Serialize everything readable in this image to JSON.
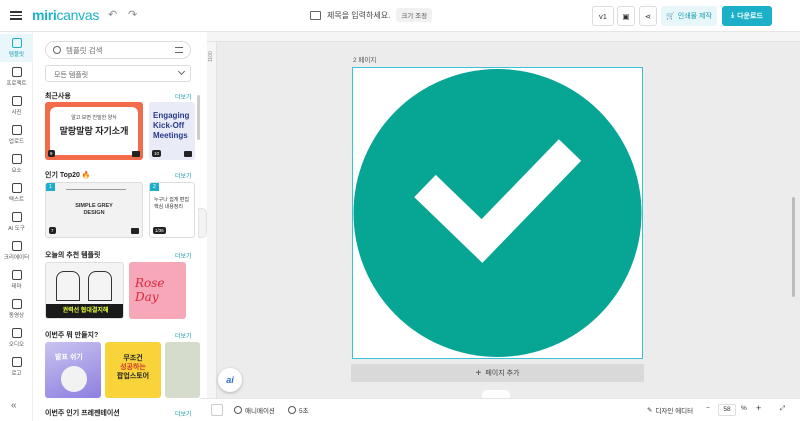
{
  "app": {
    "logo_text": "miri",
    "logo_text2": "canvas",
    "title_placeholder": "제목을 입력하세요.",
    "size_chip": "크기 조정",
    "version": "v1",
    "print_label": "인쇄물 제작",
    "download_label": "다운로드"
  },
  "rail": [
    {
      "label": "템플릿",
      "icon": "template-icon"
    },
    {
      "label": "프로젝트",
      "icon": "project-icon"
    },
    {
      "label": "사진",
      "icon": "photo-icon"
    },
    {
      "label": "업로드",
      "icon": "upload-icon"
    },
    {
      "label": "요소",
      "icon": "elements-icon"
    },
    {
      "label": "텍스트",
      "icon": "text-icon"
    },
    {
      "label": "AI 도구",
      "icon": "ai-tools-icon"
    },
    {
      "label": "크리에이터",
      "icon": "creator-icon"
    },
    {
      "label": "테마",
      "icon": "theme-icon"
    },
    {
      "label": "동영상",
      "icon": "video-icon"
    },
    {
      "label": "오디오",
      "icon": "audio-icon"
    },
    {
      "label": "로고",
      "icon": "logo-icon"
    }
  ],
  "panel": {
    "search_placeholder": "템플릿 검색",
    "select_value": "모든 템플릿",
    "more": "더보기",
    "sections": {
      "recent": "최근사용",
      "top20": "인기 Top20 🔥",
      "recommend": "오늘의 추천 템플릿",
      "week": "이번주 뭐 만들지?",
      "presentation": "이번주 인기 프레젠테이션"
    },
    "thumbs": {
      "t1_top": "알고 보면 친밀한 양식",
      "t1_main": "말랑말랑 자기소개",
      "t1_num": "9",
      "t2_line1": "Engaging",
      "t2_line2": "Kick-Off",
      "t2_line3": "Meetings",
      "t2_num": "10",
      "t3_line1": "SIMPLE GREY",
      "t3_line2": "DESIGN",
      "t3_badge": "1",
      "t3_num": "7",
      "t4_line1": "누구나 쉽게 편집",
      "t4_line2": "핵심 내용정리",
      "t4_badge": "2",
      "t4_num": "1/36",
      "t5_banner": "권력선 협대결지해",
      "t6_text": "Rose Day",
      "t7_text": "발표 쉬기",
      "t8_line1": "무조건",
      "t8_line2": "성공하는",
      "t8_line3": "팝업스토어"
    }
  },
  "canvas": {
    "ruler_label": "1100",
    "page_label": "2 페이지",
    "add_page": "페이지 추가",
    "accent_color": "#06a594",
    "ai_label": "ai"
  },
  "bottom": {
    "animation": "애니메이션",
    "duration": "5초",
    "design_editor": "디자인 에디터",
    "zoom_value": "58",
    "zoom_unit": "%",
    "zoom_minus": "−",
    "zoom_plus": "+"
  }
}
